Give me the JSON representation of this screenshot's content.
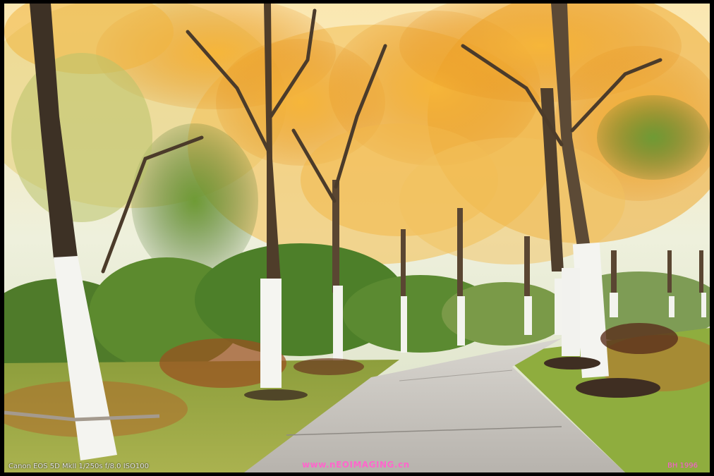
{
  "scene": {
    "description_colors": {
      "sky": "#e9efe4",
      "foliage_gold": "#f0a623",
      "foliage_green": "#5f8a2c",
      "path": "#bfbcb6",
      "grass": "#9fb64a",
      "trunk_paint": "#f4f4f0"
    }
  },
  "overlay": {
    "camera_caption": "Canon EOS 5D MkII  1/250s  f/8.0  ISO100",
    "watermark": "www.nEOIMAGING.cn",
    "signature": "BH 1996"
  }
}
